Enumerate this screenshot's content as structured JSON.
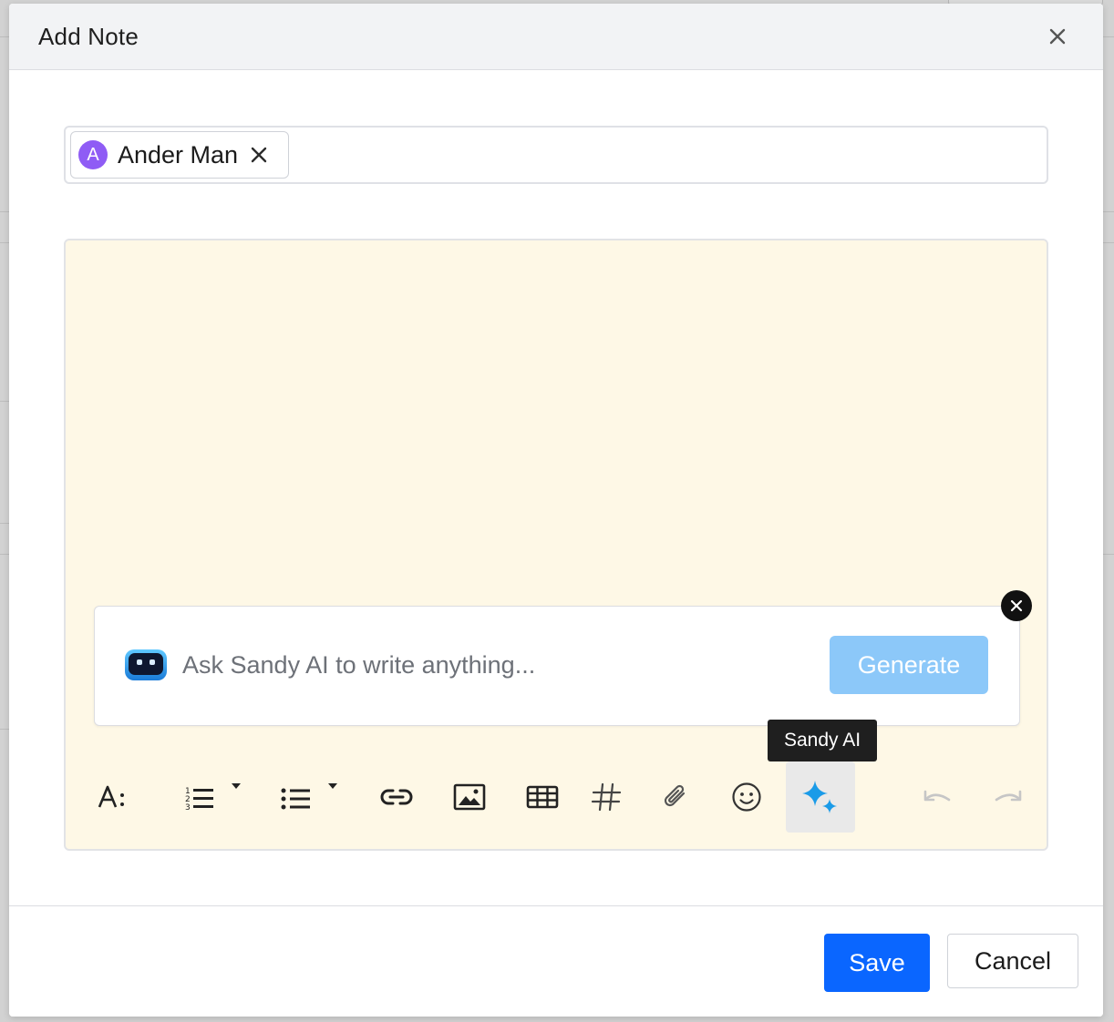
{
  "modal": {
    "title": "Add Note"
  },
  "recipients": [
    {
      "initial": "A",
      "name": "Ander Man"
    }
  ],
  "ai_prompt": {
    "placeholder": "Ask Sandy AI to write anything...",
    "generate_label": "Generate"
  },
  "tooltip": {
    "text": "Sandy AI"
  },
  "toolbar": {
    "items": [
      {
        "name": "text-format-icon"
      },
      {
        "name": "numbered-list-icon"
      },
      {
        "name": "bulleted-list-icon"
      },
      {
        "name": "link-icon"
      },
      {
        "name": "image-icon"
      },
      {
        "name": "table-icon"
      },
      {
        "name": "hashtag-icon"
      },
      {
        "name": "attachment-icon"
      },
      {
        "name": "emoji-icon"
      },
      {
        "name": "sparkle-icon",
        "active": true
      },
      {
        "name": "undo-icon"
      },
      {
        "name": "redo-icon"
      }
    ]
  },
  "footer": {
    "save_label": "Save",
    "cancel_label": "Cancel"
  },
  "colors": {
    "primary": "#0a66ff",
    "generate_disabled": "#8cc8f9",
    "editor_background": "#fef8e6",
    "avatar": "#8f5cf5",
    "sparkle": "#1a9be8"
  }
}
